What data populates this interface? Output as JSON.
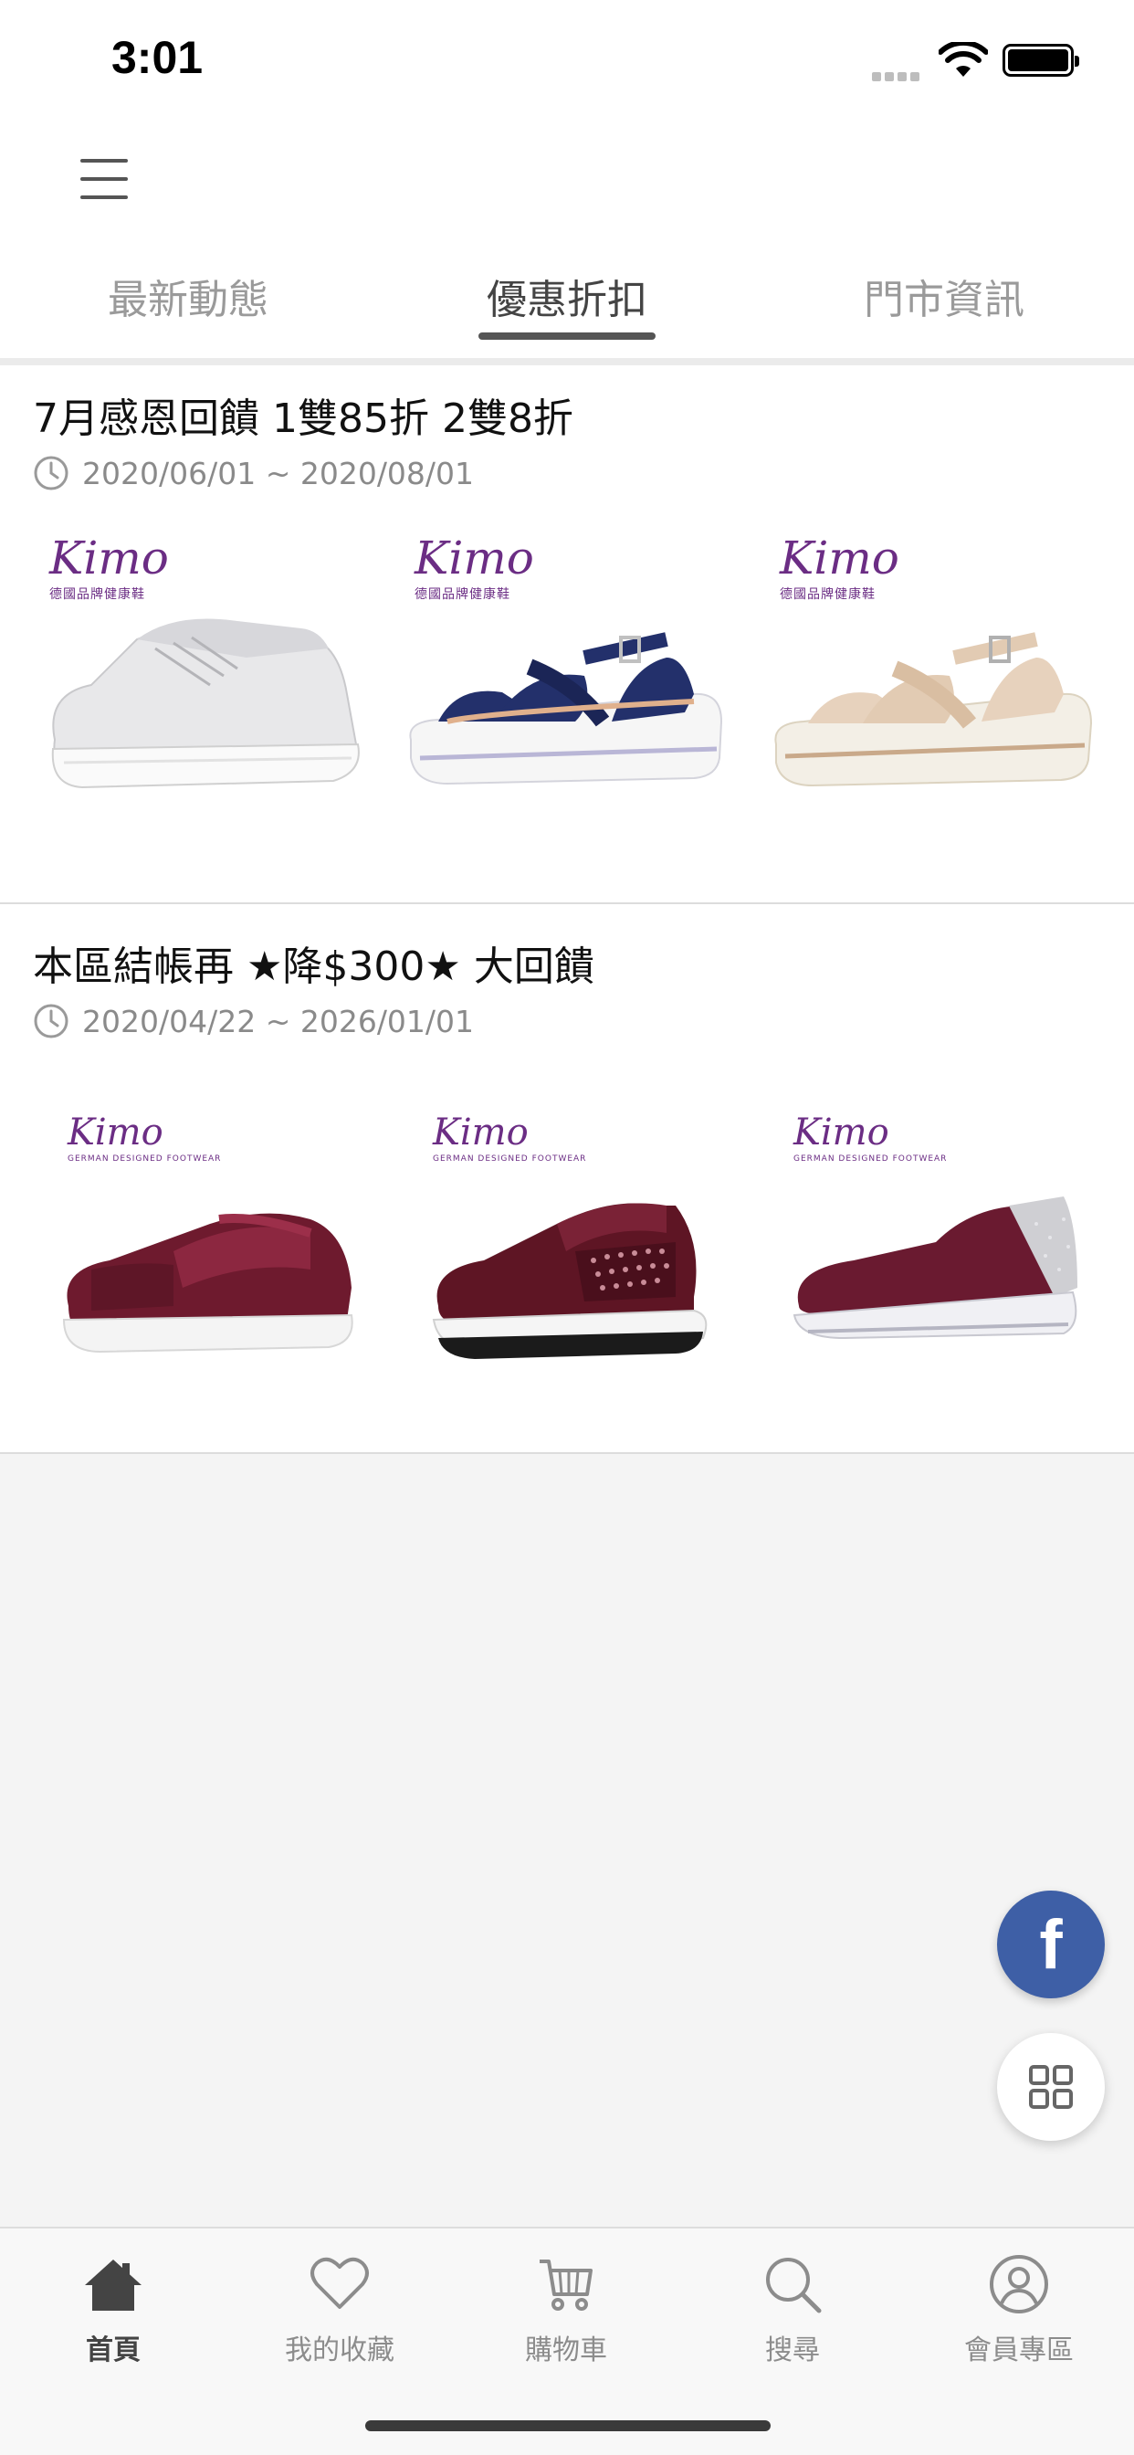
{
  "status_bar": {
    "time": "3:01"
  },
  "header": {
    "tabs": [
      {
        "label": "最新動態"
      },
      {
        "label": "優惠折扣"
      },
      {
        "label": "門市資訊"
      }
    ],
    "active_tab": "優惠折扣"
  },
  "promotions": [
    {
      "title": "7月感恩回饋 1雙85折 2雙8折",
      "date": "2020/06/01 ~ 2020/08/01",
      "products": [
        {
          "brand": "Kimo",
          "brand_sub": "德國品牌健康鞋",
          "shoe": "silver sneaker"
        },
        {
          "brand": "Kimo",
          "brand_sub": "德國品牌健康鞋",
          "shoe": "navy wedge sandal"
        },
        {
          "brand": "Kimo",
          "brand_sub": "德國品牌健康鞋",
          "shoe": "beige wedge sandal"
        }
      ]
    },
    {
      "title": "本區結帳再 ★降$300★ 大回饋",
      "date": "2020/04/22 ~ 2026/01/01",
      "products": [
        {
          "brand": "Kimo",
          "brand_sub": "GERMAN DESIGNED FOOTWEAR",
          "shoe": "burgundy slip-on"
        },
        {
          "brand": "Kimo",
          "brand_sub": "GERMAN DESIGNED FOOTWEAR",
          "shoe": "burgundy studded sneaker"
        },
        {
          "brand": "Kimo",
          "brand_sub": "GERMAN DESIGNED FOOTWEAR",
          "shoe": "burgundy wedge slip-on"
        }
      ]
    }
  ],
  "floating": {
    "facebook_label": "f"
  },
  "tabbar": [
    {
      "label": "首頁",
      "icon": "home-icon",
      "active": true
    },
    {
      "label": "我的收藏",
      "icon": "heart-icon",
      "active": false
    },
    {
      "label": "購物車",
      "icon": "cart-icon",
      "active": false
    },
    {
      "label": "搜尋",
      "icon": "search-icon",
      "active": false
    },
    {
      "label": "會員專區",
      "icon": "user-icon",
      "active": false
    }
  ],
  "colors": {
    "brand_purple": "#6b2d84",
    "facebook_blue": "#3e5fa6",
    "shoe_burgundy": "#6e1a2e",
    "sandal_navy": "#23306b"
  }
}
